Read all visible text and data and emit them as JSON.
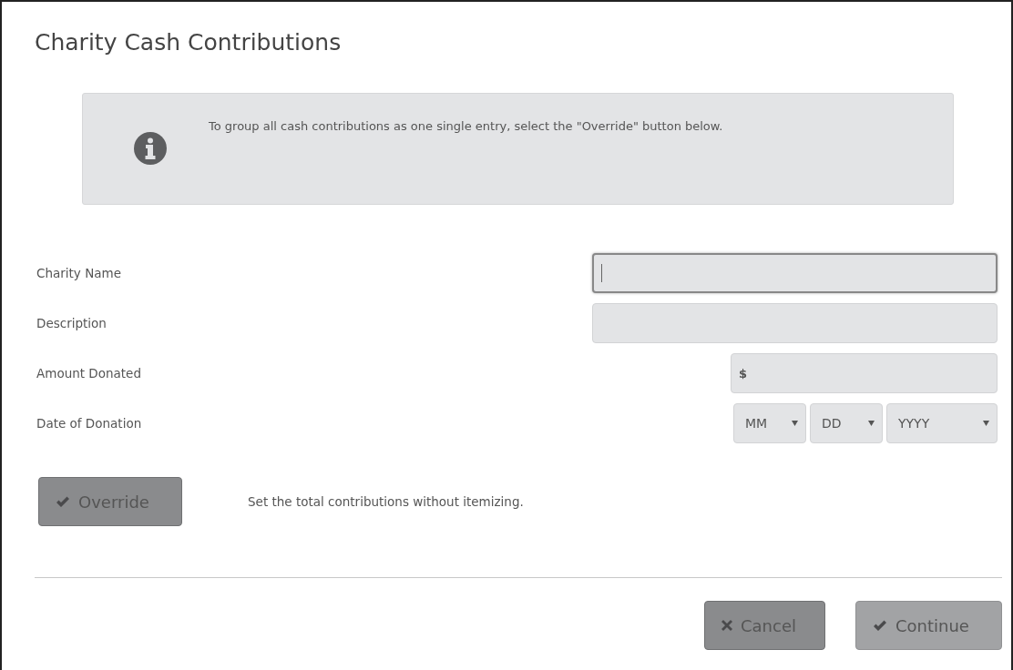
{
  "dialog": {
    "title": "Charity Cash Contributions"
  },
  "info": {
    "message": "To group all cash contributions as one single entry, select the \"Override\" button below."
  },
  "fields": [
    {
      "kind": "text",
      "label": "Charity Name",
      "focused": true
    },
    {
      "kind": "text",
      "label": "Description",
      "focused": false
    },
    {
      "kind": "currency",
      "label": "Amount Donated",
      "prefix": "$",
      "focused": false
    },
    {
      "kind": "date",
      "label": "Date of Donation",
      "parts": [
        "MM",
        "DD",
        "YYYY"
      ]
    }
  ],
  "override": {
    "label": "Override",
    "note": "Set the total contributions without itemizing."
  },
  "buttons": [
    {
      "kind": "cancel",
      "label": "Cancel",
      "disabled": false
    },
    {
      "kind": "continue",
      "label": "Continue",
      "disabled": true
    }
  ]
}
